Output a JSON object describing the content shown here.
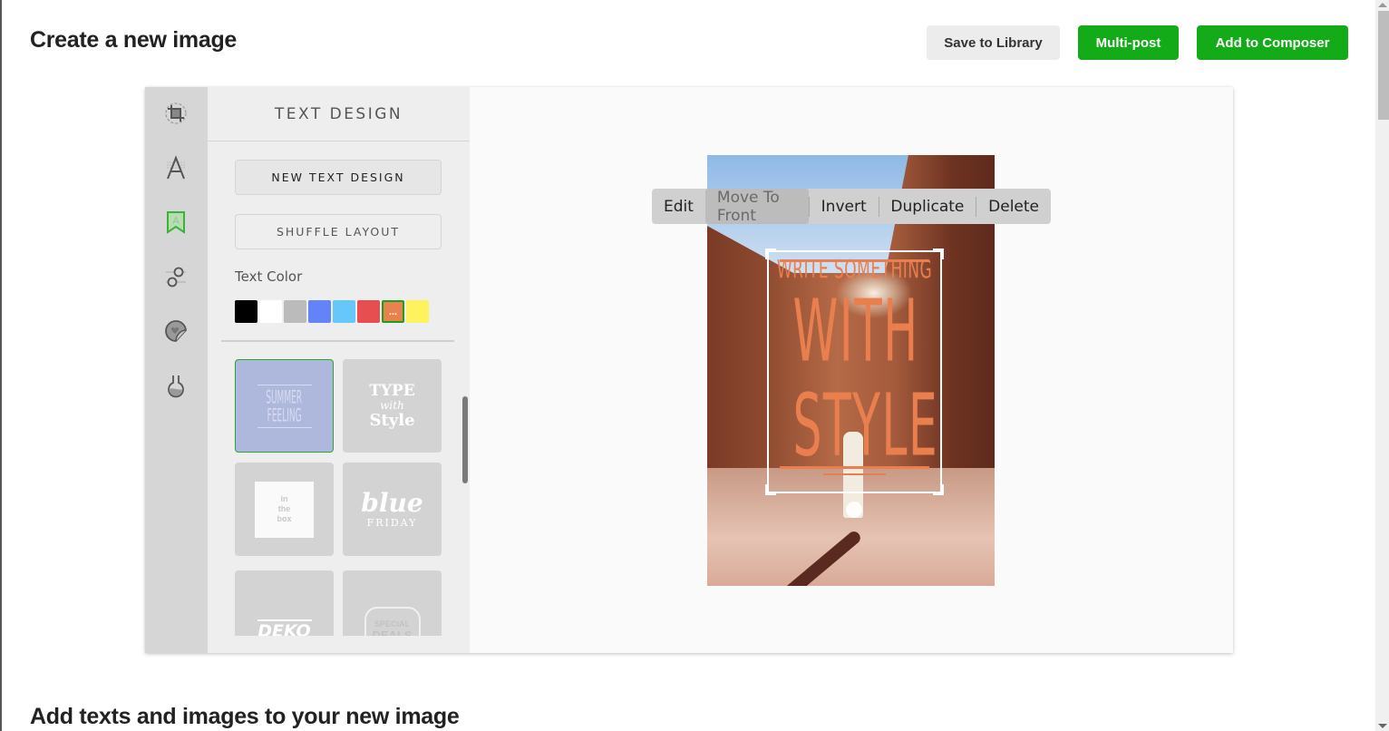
{
  "header": {
    "title": "Create a new image",
    "save_label": "Save to Library",
    "multipost_label": "Multi-post",
    "composer_label": "Add to Composer"
  },
  "toolrail": {
    "items": [
      {
        "icon": "crop-icon",
        "active": false
      },
      {
        "icon": "font-icon",
        "active": false
      },
      {
        "icon": "text-design-bookmark-icon",
        "active": true
      },
      {
        "icon": "adjust-sliders-icon",
        "active": false
      },
      {
        "icon": "sticker-icon",
        "active": false
      },
      {
        "icon": "filter-flask-icon",
        "active": false
      }
    ]
  },
  "panel": {
    "title": "TEXT DESIGN",
    "new_text_design": "NEW TEXT DESIGN",
    "shuffle_layout": "SHUFFLE LAYOUT",
    "text_color_label": "Text Color",
    "swatches": [
      {
        "color": "#000000"
      },
      {
        "color": "#ffffff"
      },
      {
        "color": "#bbbbbb"
      },
      {
        "color": "#6483f8"
      },
      {
        "color": "#66c7fa"
      },
      {
        "color": "#e74e4f"
      },
      {
        "color": "#e9824d",
        "selected": true,
        "label": "..."
      },
      {
        "color": "#fef35f"
      }
    ],
    "templates": [
      {
        "line1": "SUMMER",
        "line2": "FEELING",
        "selected": true
      },
      {
        "line1": "TYPE",
        "line2": "with",
        "line3": "Style"
      },
      {
        "line1": "in",
        "line2": "the",
        "line3": "box"
      },
      {
        "line1": "blue",
        "line2": "FRIDAY"
      },
      {
        "line1": "DEKO"
      },
      {
        "line1": "SPECIAL",
        "line2": "DEALS"
      }
    ]
  },
  "canvas": {
    "context_menu": {
      "edit": "Edit",
      "move_to_front": "Move To Front",
      "invert": "Invert",
      "duplicate": "Duplicate",
      "delete": "Delete"
    },
    "design_text": {
      "small": "WRITE SOMETHING",
      "big1": "WITH",
      "big2": "STYLE"
    },
    "accent_color": "#e9824d"
  },
  "footer": {
    "section_title": "Add texts and images to your new image"
  }
}
